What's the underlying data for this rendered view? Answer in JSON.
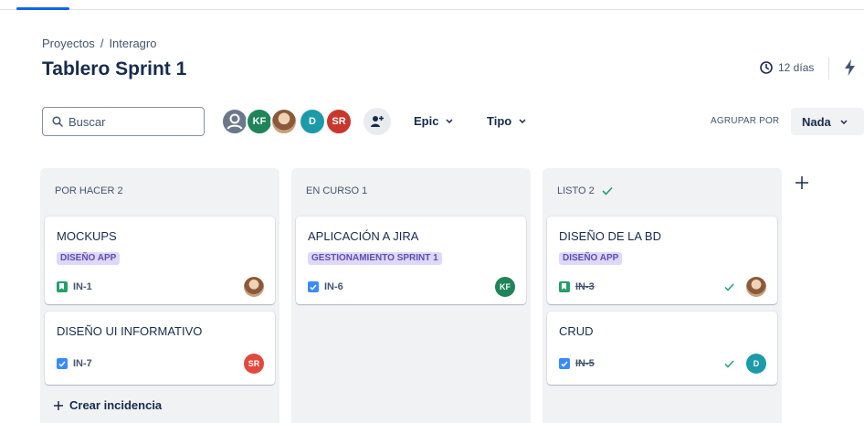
{
  "breadcrumb": {
    "project": "Proyectos",
    "separator": "/",
    "board": "Interagro"
  },
  "page": {
    "title": "Tablero Sprint 1"
  },
  "sprint": {
    "days_remaining": "12 días"
  },
  "toolbar": {
    "search_placeholder": "Buscar",
    "search_value": "",
    "avatars": [
      "user-avatar",
      "KF",
      "photo-avatar",
      "D",
      "SR"
    ],
    "filters": {
      "epic": "Epic",
      "tipo": "Tipo"
    },
    "group_by_label": "AGRUPAR POR",
    "group_by_value": "Nada"
  },
  "columns": [
    {
      "title": "POR HACER 2",
      "cards": [
        {
          "title": "MOCKUPS",
          "epic": "DISEÑO APP",
          "key": "IN-1",
          "type": "story",
          "assignee": "photo"
        },
        {
          "title": "DISEÑO UI INFORMATIVO",
          "key": "IN-7",
          "type": "task",
          "assignee": "SR"
        }
      ],
      "create_label": "Crear incidencia"
    },
    {
      "title": "EN CURSO 1",
      "cards": [
        {
          "title": "APLICACIÓN A JIRA",
          "epic": "GESTIONAMIENTO SPRINT 1",
          "key": "IN-6",
          "type": "task",
          "assignee": "KF"
        }
      ]
    },
    {
      "title": "LISTO 2",
      "done_icon": "check-icon",
      "cards": [
        {
          "title": "DISEÑO DE LA BD",
          "epic": "DISEÑO APP",
          "key": "IN-3",
          "type": "story",
          "assignee": "photo",
          "done": true
        },
        {
          "title": "CRUD",
          "key": "IN-5",
          "type": "task",
          "assignee": "D",
          "done": true
        }
      ]
    }
  ],
  "colors": {
    "accent": "#0c66e4",
    "epic_bg": "#dfd8fd",
    "epic_text": "#5e4db2",
    "done_green": "#22a06b",
    "column_bg": "#f1f2f4"
  }
}
